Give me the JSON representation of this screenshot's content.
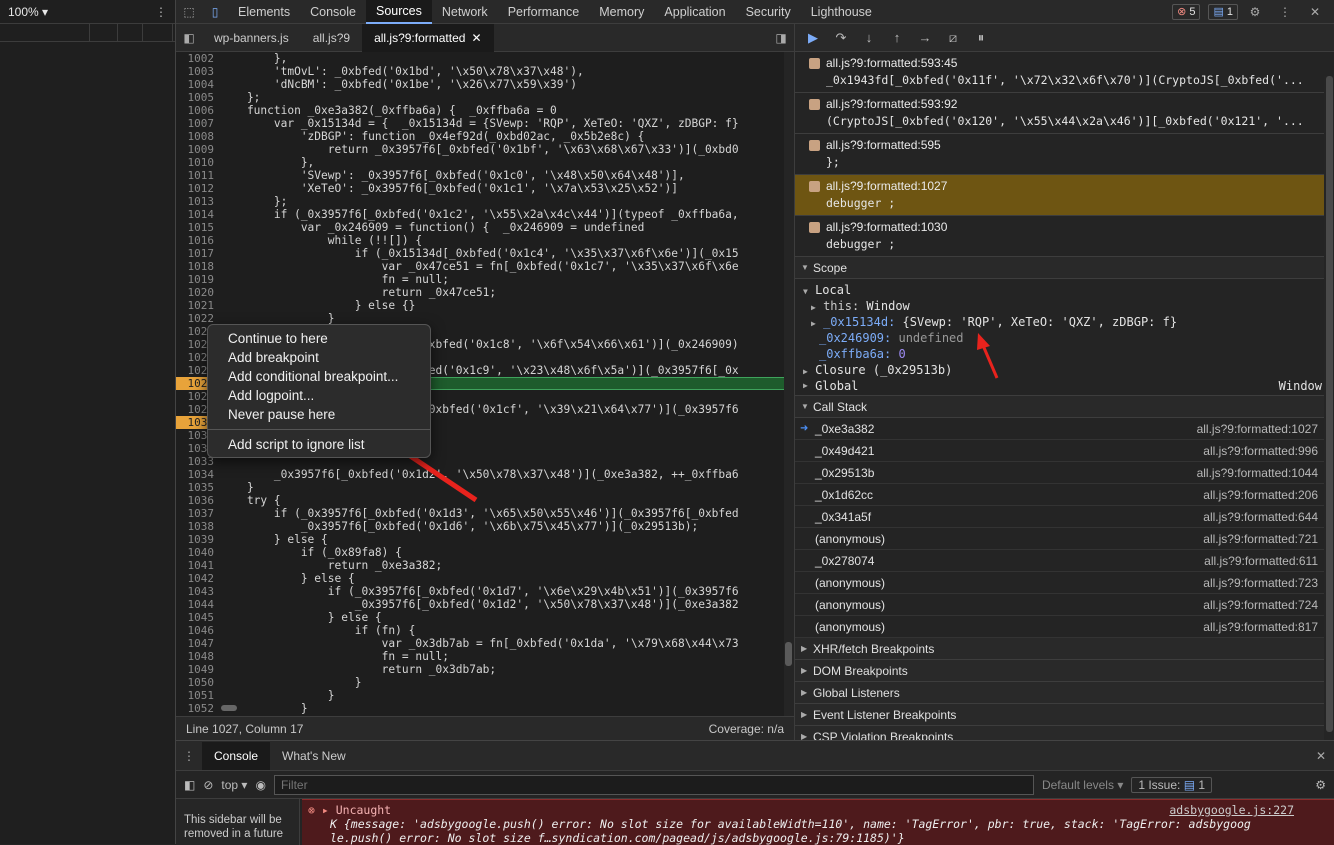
{
  "left_pane": {
    "zoom": "100%"
  },
  "devtools_tabs": [
    "Elements",
    "Console",
    "Sources",
    "Network",
    "Performance",
    "Memory",
    "Application",
    "Security",
    "Lighthouse"
  ],
  "active_tab": "Sources",
  "badges": {
    "errors": "5",
    "messages": "1"
  },
  "file_tabs": [
    "wp-banners.js",
    "all.js?9",
    "all.js?9:formatted"
  ],
  "active_file_tab": "all.js?9:formatted",
  "code": {
    "line_numbers": [
      "1002",
      "1003",
      "1004",
      "1005",
      "1006",
      "1007",
      "1008",
      "1009",
      "1010",
      "1011",
      "1012",
      "1013",
      "1014",
      "1015",
      "1016",
      "1017",
      "1018",
      "1019",
      "1020",
      "1021",
      "1022",
      "1023",
      "1024",
      "1025",
      "1026",
      "1027",
      "1028",
      "1029",
      "1030",
      "1031",
      "1032",
      "1033",
      "1034",
      "1035",
      "1036",
      "1037",
      "1038",
      "1039",
      "1040",
      "1041",
      "1042",
      "1043",
      "1044",
      "1045",
      "1046",
      "1047",
      "1048",
      "1049",
      "1050",
      "1051",
      "1052",
      "1053"
    ],
    "lines": [
      "        },",
      "        'tmOvL': _0xbfed('0x1bd', '\\x50\\x78\\x37\\x48'),",
      "        'dNcBM': _0xbfed('0x1be', '\\x26\\x77\\x59\\x39')",
      "    };",
      "    function _0xe3a382(_0xffba6a) {  _0xffba6a = 0",
      "        var _0x15134d = {  _0x15134d = {SVewp: 'RQP', XeTeO: 'QXZ', zDBGP: f}",
      "            'zDBGP': function _0x4ef92d(_0xbd02ac, _0x5b2e8c) {",
      "                return _0x3957f6[_0xbfed('0x1bf', '\\x63\\x68\\x67\\x33')](_0xbd0",
      "            },",
      "            'SVewp': _0x3957f6[_0xbfed('0x1c0', '\\x48\\x50\\x64\\x48')],",
      "            'XeTeO': _0x3957f6[_0xbfed('0x1c1', '\\x7a\\x53\\x25\\x52')]",
      "        };",
      "        if (_0x3957f6[_0xbfed('0x1c2', '\\x55\\x2a\\x4c\\x44')](typeof _0xffba6a,",
      "            var _0x246909 = function() {  _0x246909 = undefined",
      "                while (!![]) {",
      "                    if (_0x15134d[_0xbfed('0x1c4', '\\x35\\x37\\x6f\\x6e')](_0x15",
      "                        var _0x47ce51 = fn[_0xbfed('0x1c7', '\\x35\\x37\\x6f\\x6e",
      "                        fn = null;",
      "                        return _0x47ce51;",
      "                    } else {}",
      "                }",
      "            };",
      "                             _0xbfed('0x1c8', '\\x6f\\x54\\x66\\x61')](_0x246909)",
      "",
      "                             bfed('0x1c9', '\\x23\\x48\\x6f\\x5a')](_0x3957f6[_0x",
      "",
      "",
      "                             [_0xbfed('0x1cf', '\\x39\\x21\\x64\\x77')](_0x3957f6",
      "",
      "",
      "",
      "",
      "        _0x3957f6[_0xbfed('0x1d2', '\\x50\\x78\\x37\\x48')](_0xe3a382, ++_0xffba6",
      "    }",
      "    try {",
      "        if (_0x3957f6[_0xbfed('0x1d3', '\\x65\\x50\\x55\\x46')](_0x3957f6[_0xbfed",
      "            _0x3957f6[_0xbfed('0x1d6', '\\x6b\\x75\\x45\\x77')](_0x29513b);",
      "        } else {",
      "            if (_0x89fa8) {",
      "                return _0xe3a382;",
      "            } else {",
      "                if (_0x3957f6[_0xbfed('0x1d7', '\\x6e\\x29\\x4b\\x51')](_0x3957f6",
      "                    _0x3957f6[_0xbfed('0x1d2', '\\x50\\x78\\x37\\x48')](_0xe3a382",
      "                } else {",
      "                    if (fn) {",
      "                        var _0x3db7ab = fn[_0xbfed('0x1da', '\\x79\\x68\\x44\\x73",
      "                        fn = null;",
      "                        return _0x3db7ab;",
      "                    }",
      "                }",
      "            }",
      ""
    ]
  },
  "status": {
    "position": "Line 1027, Column 17",
    "coverage": "Coverage: n/a"
  },
  "context_menu": [
    "Continue to here",
    "Add breakpoint",
    "Add conditional breakpoint...",
    "Add logpoint...",
    "Never pause here",
    "Add script to ignore list"
  ],
  "breakpoints": [
    {
      "loc": "all.js?9:formatted:593:45",
      "snippet": "_0x1943fd[_0xbfed('0x11f', '\\x72\\x32\\x6f\\x70')](CryptoJS[_0xbfed('..."
    },
    {
      "loc": "all.js?9:formatted:593:92",
      "snippet": "(CryptoJS[_0xbfed('0x120', '\\x55\\x44\\x2a\\x46')][_0xbfed('0x121', '..."
    },
    {
      "loc": "all.js?9:formatted:595",
      "snippet": "};"
    },
    {
      "loc": "all.js?9:formatted:1027",
      "snippet": "debugger ;"
    },
    {
      "loc": "all.js?9:formatted:1030",
      "snippet": "debugger ;"
    }
  ],
  "scope": {
    "title": "Scope",
    "local": "Local",
    "this_label": "this:",
    "this_val": "Window",
    "v1_name": "_0x15134d:",
    "v1_val": "{SVewp: 'RQP', XeTeO: 'QXZ', zDBGP: f}",
    "v2_name": "_0x246909:",
    "v2_val": "undefined",
    "v3_name": "_0xffba6a:",
    "v3_val": "0",
    "closure": "Closure (_0x29513b)",
    "global": "Global",
    "global_val": "Window"
  },
  "call_stack": {
    "title": "Call Stack",
    "frames": [
      {
        "fn": "_0xe3a382",
        "loc": "all.js?9:formatted:1027"
      },
      {
        "fn": "_0x49d421",
        "loc": "all.js?9:formatted:996"
      },
      {
        "fn": "_0x29513b",
        "loc": "all.js?9:formatted:1044"
      },
      {
        "fn": "_0x1d62cc",
        "loc": "all.js?9:formatted:206"
      },
      {
        "fn": "_0x341a5f",
        "loc": "all.js?9:formatted:644"
      },
      {
        "fn": "(anonymous)",
        "loc": "all.js?9:formatted:721"
      },
      {
        "fn": "_0x278074",
        "loc": "all.js?9:formatted:611"
      },
      {
        "fn": "(anonymous)",
        "loc": "all.js?9:formatted:723"
      },
      {
        "fn": "(anonymous)",
        "loc": "all.js?9:formatted:724"
      },
      {
        "fn": "(anonymous)",
        "loc": "all.js?9:formatted:817"
      }
    ]
  },
  "sections": [
    "XHR/fetch Breakpoints",
    "DOM Breakpoints",
    "Global Listeners",
    "Event Listener Breakpoints",
    "CSP Violation Breakpoints"
  ],
  "drawer": {
    "tabs": [
      "Console",
      "What's New"
    ],
    "context": "top",
    "filter_placeholder": "Filter",
    "levels": "Default levels",
    "issues": "1 Issue:",
    "issues_count": "1",
    "sidebar_note": "This sidebar will be removed in a future",
    "err_title": "Uncaught",
    "err_link": "adsbygoogle.js:227",
    "err_body1": "K {message: 'adsbygoogle.push() error: No slot size for availableWidth=110', name: 'TagError', pbr: true, stack: 'TagError: adsbygoog",
    "err_body2": "le.push() error: No slot size f…syndication.com/pagead/js/adsbygoogle.js:79:1185)'}"
  }
}
